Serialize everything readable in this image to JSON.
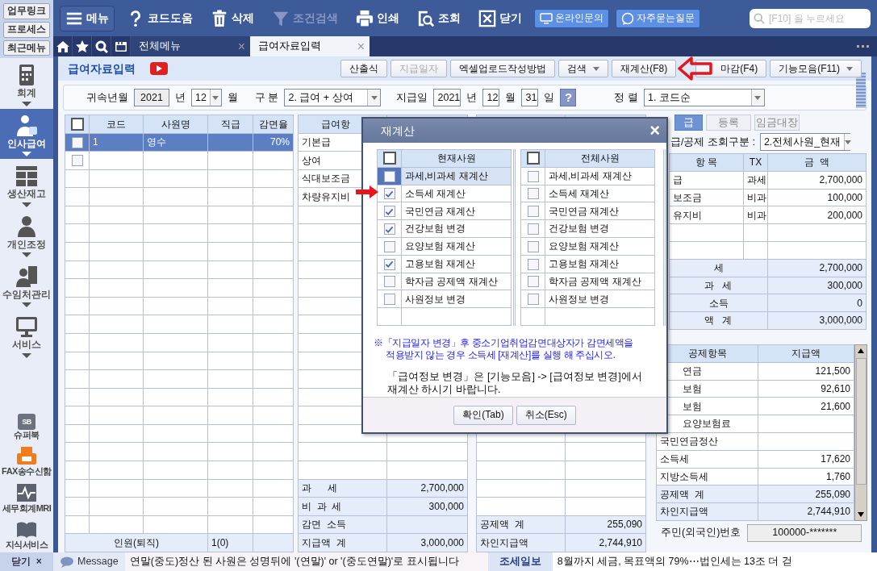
{
  "sidebar": {
    "links": [
      "업무링크",
      "프로세스",
      "최근메뉴"
    ],
    "modules": [
      {
        "label": "회계",
        "selected": false
      },
      {
        "label": "인사급여",
        "selected": true
      },
      {
        "label": "생산재고",
        "selected": false
      },
      {
        "label": "개인조정",
        "selected": false
      },
      {
        "label": "수임처관리",
        "selected": false
      },
      {
        "label": "서비스",
        "selected": false
      }
    ],
    "extras": [
      {
        "label": "슈퍼북",
        "badge": "SB"
      },
      {
        "label": "FAX송수신함"
      },
      {
        "label": "세무회계MRI"
      },
      {
        "label": "지식서비스"
      }
    ],
    "close": {
      "label": "닫기",
      "icon": "×"
    }
  },
  "toolbar": {
    "buttons": [
      {
        "label": "메뉴",
        "disabled": false
      },
      {
        "label": "코드도움",
        "disabled": false
      },
      {
        "label": "삭제",
        "disabled": false
      },
      {
        "label": "조건검색",
        "disabled": true
      },
      {
        "label": "인쇄",
        "disabled": false
      },
      {
        "label": "조회",
        "disabled": false
      },
      {
        "label": "닫기",
        "disabled": false
      }
    ],
    "help_buttons": [
      "온라인문의",
      "자주묻는질문"
    ],
    "search": {
      "placeholder": "[F10] 을 누르세요"
    }
  },
  "tabs": [
    {
      "label": "전체메뉴",
      "selected": false,
      "close": "×"
    },
    {
      "label": "급여자료입력",
      "selected": true,
      "close": "×"
    }
  ],
  "page": {
    "title": "급여자료입력",
    "actions": [
      {
        "label": "산출식",
        "disabled": false
      },
      {
        "label": "지급일자",
        "disabled": true
      },
      {
        "label": "엑셀업로드작성방법",
        "disabled": false
      },
      {
        "label": "검색",
        "disabled": false,
        "dropdown": true
      },
      {
        "label": "재계산(F8)",
        "disabled": false
      },
      {
        "label": "마감(F4)",
        "disabled": false
      },
      {
        "label": "기능모음(F11)",
        "disabled": false,
        "dropdown": true
      }
    ]
  },
  "filters": {
    "period_label": "귀속년월",
    "year": "2021",
    "year_unit": "년",
    "month": "12",
    "month_unit": "월",
    "type_label": "구 분",
    "type": "2. 급여 + 상여",
    "pay_date_label": "지급일",
    "pay_year": "2021",
    "pay_year_unit": "년",
    "pay_month": "12",
    "pay_month_unit": "월",
    "pay_day": "31",
    "pay_day_unit": "일",
    "help": "?",
    "sort_label": "정 렬",
    "sort": "1. 코드순"
  },
  "employees": {
    "all_checked": false,
    "columns": [
      "코드",
      "사원명",
      "직급",
      "감면율"
    ],
    "rows": [
      {
        "selected": true,
        "checked": false,
        "code": "1",
        "name": "영수",
        "rate": "70%"
      },
      {
        "selected": false,
        "checked": false
      }
    ],
    "footer": {
      "label": "인원(퇴직)",
      "count": "1(0)"
    }
  },
  "pay_items": {
    "header": "급여항",
    "items": [
      "기본급",
      "상여",
      "식대보조금",
      "차량유지비"
    ],
    "totals": [
      {
        "label": "과      세",
        "value": "2,700,000"
      },
      {
        "label": "비  과  세",
        "value": "300,000"
      },
      {
        "label": "감면  소득"
      },
      {
        "label": "지급액  계",
        "value": "3,000,000"
      }
    ]
  },
  "deduction_totals": [
    {
      "label": "공제액  계",
      "value": "255,090"
    },
    {
      "label": "차인지급액",
      "value": "2,744,910"
    }
  ],
  "right_panel": {
    "tabs": [
      {
        "label": "급",
        "selected": true
      },
      {
        "label": "등록",
        "selected": false
      },
      {
        "label": "임금대장",
        "selected": false
      }
    ],
    "query_label": "급/공제 조회구분 :",
    "query_value": "2.전체사원_현재",
    "pay_table": {
      "columns": [
        "항 목",
        "TX",
        "금  액"
      ],
      "rows": [
        {
          "item": "급",
          "tx": "과세",
          "amount": "2,700,000"
        },
        {
          "item": "보조금",
          "tx": "비과",
          "amount": "100,000"
        },
        {
          "item": "유지비",
          "tx": "비과",
          "amount": "200,000"
        }
      ],
      "totals": [
        {
          "label": "세",
          "value": "2,700,000"
        },
        {
          "label": "과   세",
          "value": "300,000"
        },
        {
          "label": "소득",
          "value": "0"
        },
        {
          "label": "액   계",
          "value": "3,000,000"
        }
      ]
    },
    "deduction_table": {
      "columns": [
        "공제항목",
        "지급액"
      ],
      "rows": [
        {
          "kind": "covered",
          "label": "연금",
          "amount": "121,500"
        },
        {
          "kind": "covered",
          "label": "보험",
          "amount": "92,610"
        },
        {
          "kind": "covered",
          "label": "보험",
          "amount": "21,600"
        },
        {
          "kind": "covered",
          "label": "요양보험료"
        },
        {
          "kind": "full",
          "label": "국민연금정산"
        },
        {
          "kind": "full",
          "label": "소득세",
          "amount": "17,620"
        },
        {
          "kind": "full",
          "label": "지방소득세",
          "amount": "1,760"
        },
        {
          "kind": "total",
          "label": "공제액  계",
          "amount": "255,090"
        },
        {
          "kind": "total",
          "label": "차인지급액",
          "amount": "2,744,910"
        }
      ]
    },
    "id_label": "주민(외국인)번호",
    "id_value": "100000-*******"
  },
  "dialog": {
    "title": "재계산",
    "close": "×",
    "lists": [
      {
        "header": "현재사원",
        "all_checked": false,
        "items": [
          {
            "label": "과세,비과세 재계산",
            "checked": false,
            "selected": true
          },
          {
            "label": "소득세 재계산",
            "checked": true,
            "selected": false
          },
          {
            "label": "국민연금 재계산",
            "checked": true,
            "selected": false
          },
          {
            "label": "건강보험 변경",
            "checked": true,
            "selected": false
          },
          {
            "label": "요양보험 재계산",
            "checked": false,
            "selected": false
          },
          {
            "label": "고용보험 재계산",
            "checked": true,
            "selected": false
          },
          {
            "label": "학자금 공제액 재계산",
            "checked": false,
            "selected": false
          },
          {
            "label": "사원정보 변경",
            "checked": false,
            "selected": false
          }
        ]
      },
      {
        "header": "전체사원",
        "all_checked": false,
        "items": [
          {
            "label": "과세,비과세 재계산",
            "checked": false,
            "selected": false
          },
          {
            "label": "소득세 재계산",
            "checked": false,
            "selected": false
          },
          {
            "label": "국민연금 재계산",
            "checked": false,
            "selected": false
          },
          {
            "label": "건강보험 변경",
            "checked": false,
            "selected": false
          },
          {
            "label": "요양보험 재계산",
            "checked": false,
            "selected": false
          },
          {
            "label": "고용보험 재계산",
            "checked": false,
            "selected": false
          },
          {
            "label": "학자금 공제액 재계산",
            "checked": false,
            "selected": false
          },
          {
            "label": "사원정보 변경",
            "checked": false,
            "selected": false
          }
        ]
      }
    ],
    "note": "※「지급일자 변경」후 중소기업취업감면대상자가 감면세액을\n적용받지 않는 경우 소득세 [재계산]를 실행 해 주십시오.",
    "info": "「급여정보 변경」은 [기능모음] -> [급여정보 변경]에서\n재계산 하시기 바랍니다.",
    "buttons": [
      "확인(Tab)",
      "취소(Esc)"
    ]
  },
  "status": {
    "message_label": "Message",
    "message": "연말(중도)정산 된 사원은 성명뒤에 '(연말)' or '(중도연말)'로 표시됩니다",
    "news_label": "조세일보",
    "news": "8월까지 세금, 목표액의 79%⋯법인세는 13조 더 걷"
  }
}
